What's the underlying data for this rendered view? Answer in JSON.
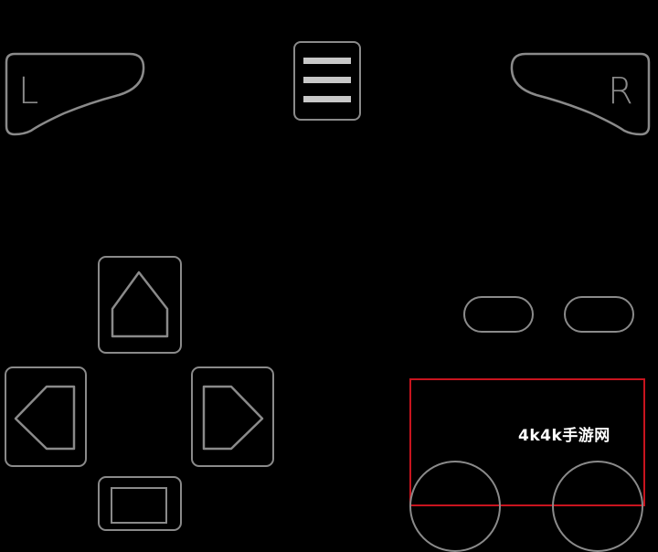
{
  "shoulder": {
    "left_label": "L",
    "right_label": "R"
  },
  "watermark": {
    "text": "4k4k手游网"
  },
  "colors": {
    "background": "#000000",
    "outline": "#8a8a8a",
    "menu_bars": "#c8c8c8",
    "highlight_border": "#c8141e",
    "watermark": "#ffffff"
  },
  "icons": {
    "menu": "hamburger-icon",
    "dpad_up": "triangle-up-icon",
    "dpad_left": "triangle-left-icon",
    "dpad_right": "triangle-right-icon",
    "dpad_down": "square-icon"
  }
}
